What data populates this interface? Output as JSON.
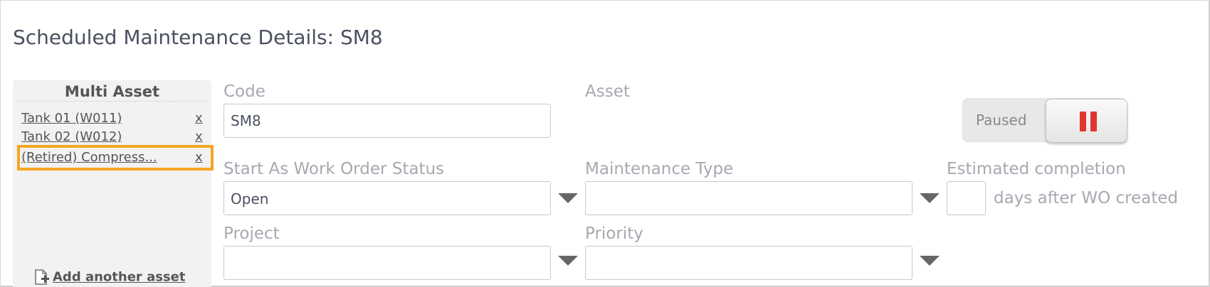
{
  "page": {
    "title": "Scheduled Maintenance Details: SM8"
  },
  "multi_asset": {
    "title": "Multi Asset",
    "items": [
      {
        "name": "Tank 01 (W011)",
        "remove": "x"
      },
      {
        "name": "Tank 02 (W012)",
        "remove": "x"
      },
      {
        "name": "(Retired) Compress...",
        "remove": "x",
        "highlighted": true
      }
    ],
    "add_label": "Add another asset"
  },
  "form": {
    "code_label": "Code",
    "code_value": "SM8",
    "asset_label": "Asset",
    "start_status_label": "Start As Work Order Status",
    "start_status_value": "Open",
    "maintenance_type_label": "Maintenance Type",
    "maintenance_type_value": "",
    "estimated_label": "Estimated completion",
    "estimated_value": "",
    "estimated_suffix": "days after WO created",
    "project_label": "Project",
    "project_value": "",
    "priority_label": "Priority",
    "priority_value": ""
  },
  "toggle": {
    "label": "Paused",
    "state": "paused",
    "pause_color": "#e0342f"
  },
  "colors": {
    "highlight": "#f5a623",
    "label_gray": "#a5a9b0",
    "title": "#4a5060"
  }
}
